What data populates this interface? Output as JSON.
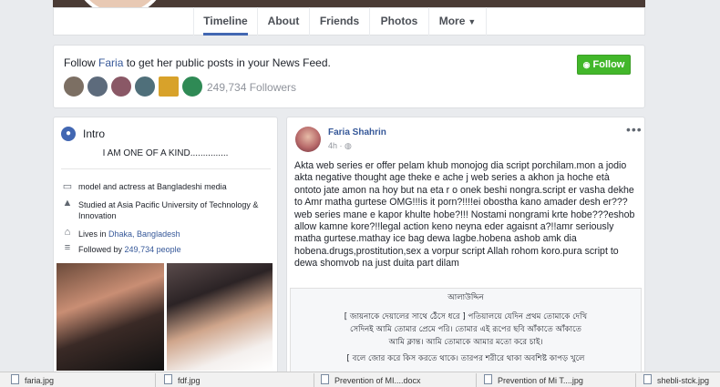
{
  "nav": {
    "tabs": [
      {
        "label": "Timeline"
      },
      {
        "label": "About"
      },
      {
        "label": "Friends"
      },
      {
        "label": "Photos"
      },
      {
        "label": "More"
      }
    ],
    "more_caret": "▼"
  },
  "follow_card": {
    "prefix": "Follow",
    "name": "Faria",
    "suffix": "to get her public posts in your News Feed.",
    "button_label": "Follow",
    "button_icon": "rss-icon",
    "followers": "249,734 Followers",
    "colors": {
      "button": "#42b72a",
      "link": "#365899"
    }
  },
  "intro": {
    "title": "Intro",
    "bio": "I AM ONE OF A KIND...............",
    "rows": [
      {
        "icon": "briefcase-icon",
        "text": "model and actress at Bangladeshi media"
      },
      {
        "icon": "graduation-cap-icon",
        "text": "Studied at Asia Pacific University of Technology & Innovation"
      },
      {
        "icon": "home-icon",
        "prefix": "Lives in",
        "link": "Dhaka, Bangladesh"
      },
      {
        "icon": "followers-icon",
        "prefix": "Followed by",
        "link": "249,734 people"
      }
    ]
  },
  "post": {
    "author": "Faria Shahrin",
    "time": "4h",
    "text": "Akta web series er offer pelam khub monojog dia script porchilam.mon a jodio akta negative thought age theke e ache j web series a akhon ja hoche età ontoto jate amon na hoy but na eta r o onek beshi nongra.script er vasha dekhe to Amr matha gurtese OMG!!!is it porn?!!!!ei obostha kano amader desh er???web series mane e kapor khulte hobe?!!! Nostami nongrami krte hobe???eshob allow kamne kore?!!legal action keno neyna eder agaisnt a?!!amr seriously matha gurtese.mathay ice bag dewa lagbe.hobena ashob amk dia hobena.drugs,prostitution,sex a vorpur script Allah rohom koro.pura script to dewa shomvob na just duita part dilam",
    "image_lines": [
      "আলাউদ্দিন",
      "[ জায়নাকে দেয়ালের সাথে ঠেঁসে ধরে ] পতিয়ালয়ে যেদিন প্রথম তোমাকে দেখি",
      "সেদিনই আমি তোমার প্রেমে পরি। তোমার এই রূপের ছবি আঁকাতে আঁকাতে",
      "আমি ক্লান্ত। আমি তোমাকে আমার মতো করে চাই।",
      "[ বলে জোর করে কিস করতে থাকে। তারপর শরীরে থাকা অবশিষ্ট কাপড় খুলে"
    ]
  },
  "downloads": [
    {
      "label": "faria.jpg"
    },
    {
      "label": "fdf.jpg"
    },
    {
      "label": "Prevention of MI....docx"
    },
    {
      "label": "Prevention of Mi T....jpg"
    },
    {
      "label": "shebli-stck.jpg"
    }
  ]
}
